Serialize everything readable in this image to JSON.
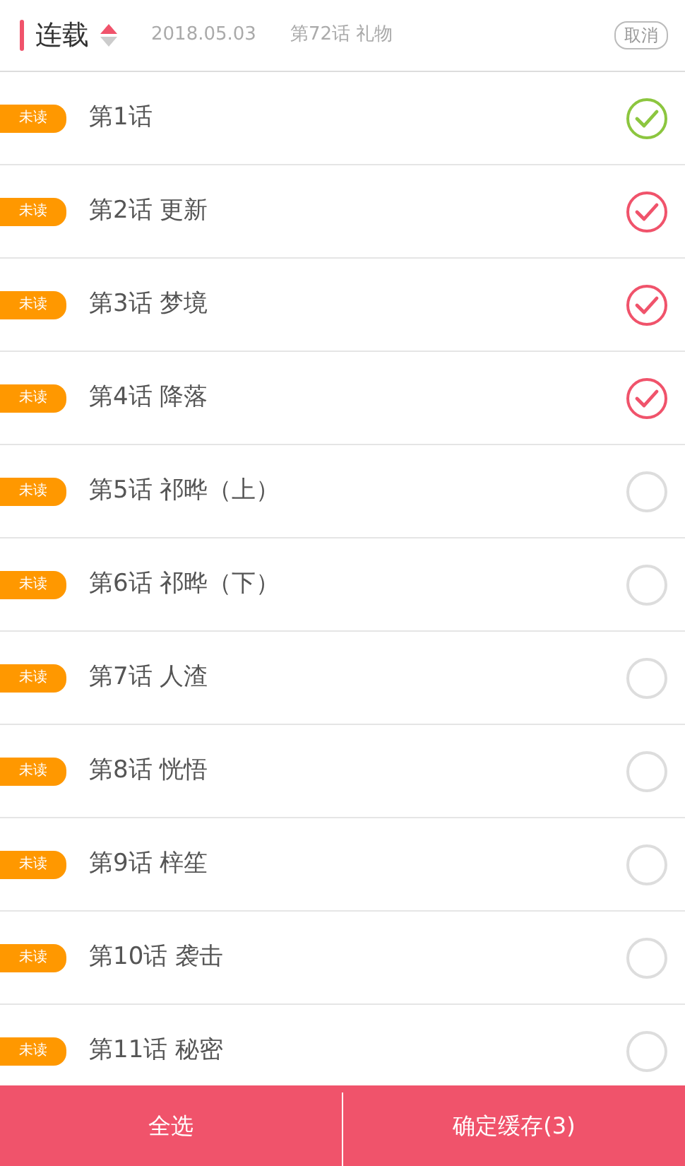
{
  "header": {
    "title": "连载",
    "sort_ascending": true,
    "date": "2018.05.03",
    "latest": "第72话 礼物",
    "cancel": "取消"
  },
  "episodes": [
    {
      "kind": "downloaded",
      "badge": "未读",
      "title": "第1话"
    },
    {
      "kind": "episode",
      "badge": "未读",
      "title": "第2话 更新",
      "selected": true
    },
    {
      "kind": "episode",
      "badge": "未读",
      "title": "第3话 梦境",
      "selected": true
    },
    {
      "kind": "episode",
      "badge": "未读",
      "title": "第4话 降落",
      "selected": true
    },
    {
      "kind": "episode",
      "badge": "未读",
      "title": "第5话 祁晔（上）",
      "selected": false
    },
    {
      "kind": "episode",
      "badge": "未读",
      "title": "第6话 祁晔（下）",
      "selected": false
    },
    {
      "kind": "episode",
      "badge": "未读",
      "title": "第7话 人渣",
      "selected": false
    },
    {
      "kind": "episode",
      "badge": "未读",
      "title": "第8话 恍悟",
      "selected": false
    },
    {
      "kind": "episode",
      "badge": "未读",
      "title": "第9话 梓笙",
      "selected": false
    },
    {
      "kind": "episode",
      "badge": "未读",
      "title": "第10话 袭击",
      "selected": false
    },
    {
      "kind": "episode",
      "badge": "未读",
      "title": "第11话 秘密",
      "selected": false
    }
  ],
  "footer": {
    "select_all": "全选",
    "confirm": "确定缓存(3)"
  }
}
